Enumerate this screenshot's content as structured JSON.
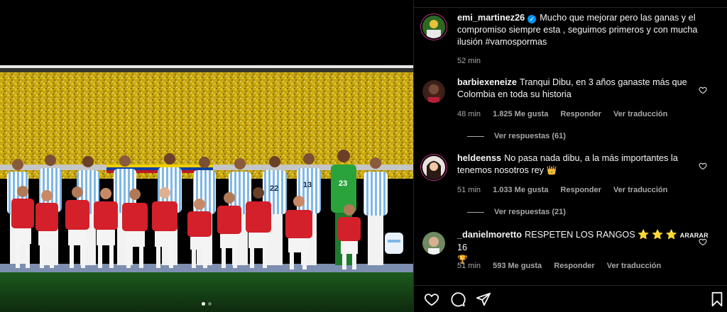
{
  "post": {
    "author": "emi_martinez26",
    "caption": "Mucho que mejorar pero las ganas y el compromiso siempre esta , seguimos primeros y con mucha ilusión #vamospormas",
    "time": "52 min"
  },
  "comments": [
    {
      "user": "barbiexeneize",
      "text": "Tranqui Dibu, en 3 años ganaste más que Colombia en toda su historia",
      "time": "48 min",
      "likes": "1.825 Me gusta",
      "reply": "Responder",
      "translate": "Ver traducción",
      "view_replies": "Ver respuestas (61)"
    },
    {
      "user": "heldeenss",
      "text": "No pasa nada dibu, a la más importantes la tenemos nosotros rey",
      "emoji": "👑",
      "time": "51 min",
      "likes": "1.033 Me gusta",
      "reply": "Responder",
      "translate": "Ver traducción",
      "view_replies": "Ver respuestas (21)"
    },
    {
      "user": "_danielmoretto",
      "text": "RESPETEN LOS RANGOS",
      "stars": "⭐ ⭐ ⭐",
      "caps": "ARARAR",
      "tail": "16",
      "trophy": "🏆",
      "time": "51 min",
      "likes": "593 Me gusta",
      "reply": "Responder",
      "translate": "Ver traducción"
    }
  ],
  "photo": {
    "banner_text": "TOLERANCIA"
  },
  "colors": {
    "accent_blue": "#0095f6",
    "muted": "#a8a8a8",
    "crowd_yellow": "#e9c81a",
    "argentina_blue": "#7fb8e6",
    "kid_red": "#d3202a",
    "keeper_green": "#2aa33c"
  },
  "icons": [
    "verified-icon",
    "heart-icon",
    "comment-icon",
    "share-icon",
    "bookmark-icon"
  ]
}
